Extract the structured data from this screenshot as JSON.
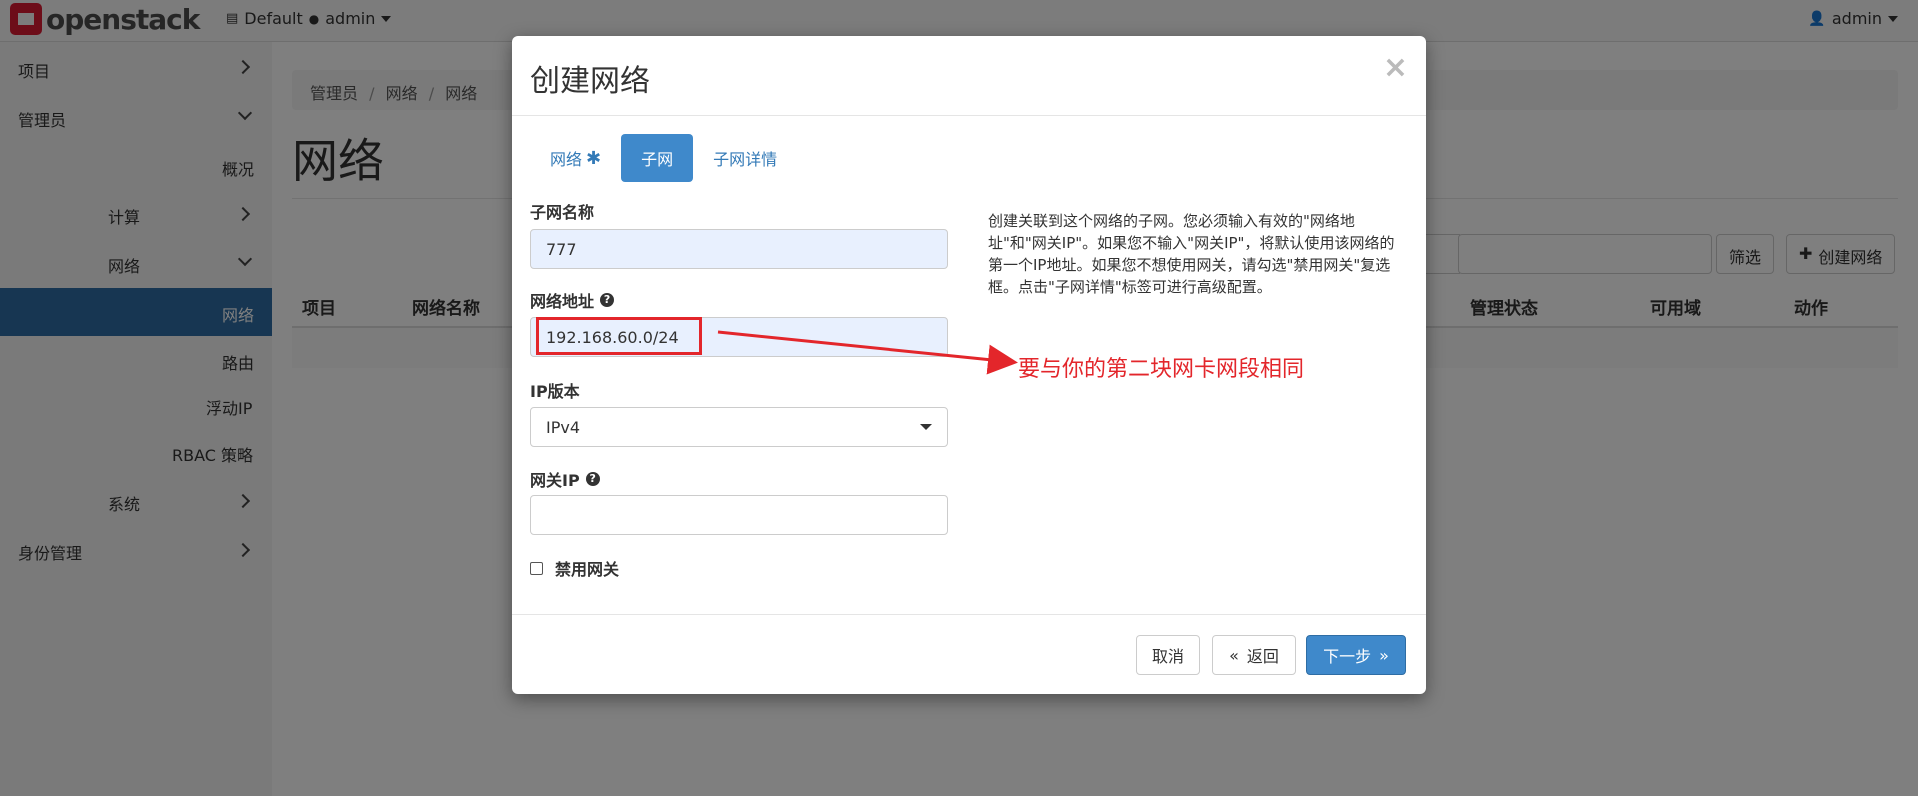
{
  "topbar": {
    "brand": "openstack",
    "domain_label": "Default",
    "project_label": "admin",
    "user_label": "admin"
  },
  "sidebar": {
    "items": [
      {
        "label": "项目"
      },
      {
        "label": "管理员"
      },
      {
        "label": "概况"
      },
      {
        "label": "计算"
      },
      {
        "label": "网络"
      },
      {
        "label": "网络"
      },
      {
        "label": "路由"
      },
      {
        "label": "浮动IP"
      },
      {
        "label": "RBAC 策略"
      },
      {
        "label": "系统"
      },
      {
        "label": "身份管理"
      }
    ]
  },
  "page": {
    "breadcrumb": [
      "管理员",
      "网络",
      "网络"
    ],
    "title": "网络",
    "filter_button": "筛选",
    "create_button": "创建网络",
    "table_headers": [
      "项目",
      "网络名称",
      "管理状态",
      "可用域",
      "动作"
    ]
  },
  "modal": {
    "title": "创建网络",
    "close": "×",
    "tabs": [
      {
        "label": "网络",
        "required_mark": "✱"
      },
      {
        "label": "子网"
      },
      {
        "label": "子网详情"
      }
    ],
    "fields": {
      "subnet_name_label": "子网名称",
      "subnet_name_value": "777",
      "network_address_label": "网络地址",
      "network_address_value": "192.168.60.0/24",
      "ip_version_label": "IP版本",
      "ip_version_value": "IPv4",
      "gateway_label": "网关IP",
      "gateway_value": "",
      "disable_gateway_label": "禁用网关"
    },
    "help_text": "创建关联到这个网络的子网。您必须输入有效的\"网络地址\"和\"网关IP\"。如果您不输入\"网关IP\"，将默认使用该网络的第一个IP地址。如果您不想使用网关，请勾选\"禁用网关\"复选框。点击\"子网详情\"标签可进行高级配置。",
    "buttons": {
      "cancel": "取消",
      "back": "返回",
      "back_glyph": "«",
      "next": "下一步",
      "next_glyph": "»"
    }
  },
  "annotation": {
    "text": "要与你的第二块网卡网段相同",
    "color": "#e3262b"
  },
  "colors": {
    "primary": "#3f89cb",
    "sidebar_active": "#2e6da4",
    "brand_red": "#da1a32"
  }
}
